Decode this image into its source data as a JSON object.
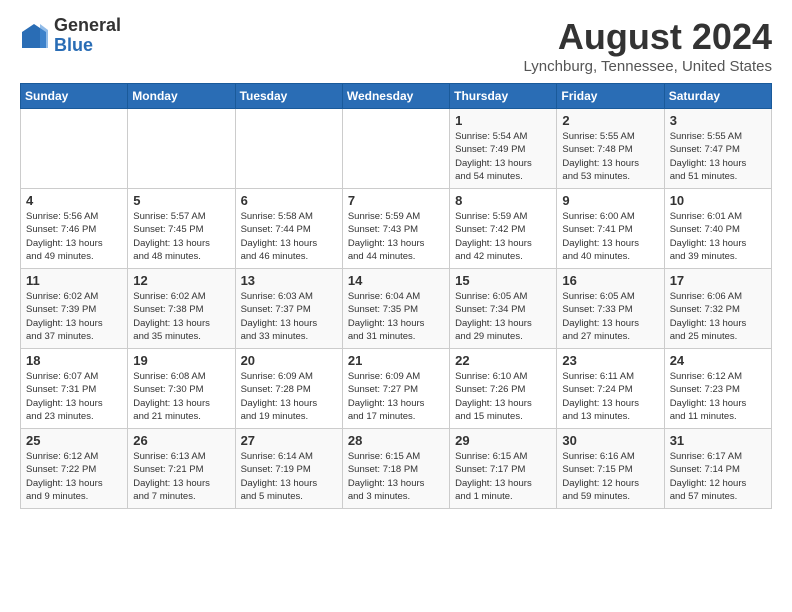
{
  "logo": {
    "general": "General",
    "blue": "Blue"
  },
  "title": "August 2024",
  "location": "Lynchburg, Tennessee, United States",
  "days_of_week": [
    "Sunday",
    "Monday",
    "Tuesday",
    "Wednesday",
    "Thursday",
    "Friday",
    "Saturday"
  ],
  "weeks": [
    [
      {
        "day": "",
        "info": ""
      },
      {
        "day": "",
        "info": ""
      },
      {
        "day": "",
        "info": ""
      },
      {
        "day": "",
        "info": ""
      },
      {
        "day": "1",
        "info": "Sunrise: 5:54 AM\nSunset: 7:49 PM\nDaylight: 13 hours\nand 54 minutes."
      },
      {
        "day": "2",
        "info": "Sunrise: 5:55 AM\nSunset: 7:48 PM\nDaylight: 13 hours\nand 53 minutes."
      },
      {
        "day": "3",
        "info": "Sunrise: 5:55 AM\nSunset: 7:47 PM\nDaylight: 13 hours\nand 51 minutes."
      }
    ],
    [
      {
        "day": "4",
        "info": "Sunrise: 5:56 AM\nSunset: 7:46 PM\nDaylight: 13 hours\nand 49 minutes."
      },
      {
        "day": "5",
        "info": "Sunrise: 5:57 AM\nSunset: 7:45 PM\nDaylight: 13 hours\nand 48 minutes."
      },
      {
        "day": "6",
        "info": "Sunrise: 5:58 AM\nSunset: 7:44 PM\nDaylight: 13 hours\nand 46 minutes."
      },
      {
        "day": "7",
        "info": "Sunrise: 5:59 AM\nSunset: 7:43 PM\nDaylight: 13 hours\nand 44 minutes."
      },
      {
        "day": "8",
        "info": "Sunrise: 5:59 AM\nSunset: 7:42 PM\nDaylight: 13 hours\nand 42 minutes."
      },
      {
        "day": "9",
        "info": "Sunrise: 6:00 AM\nSunset: 7:41 PM\nDaylight: 13 hours\nand 40 minutes."
      },
      {
        "day": "10",
        "info": "Sunrise: 6:01 AM\nSunset: 7:40 PM\nDaylight: 13 hours\nand 39 minutes."
      }
    ],
    [
      {
        "day": "11",
        "info": "Sunrise: 6:02 AM\nSunset: 7:39 PM\nDaylight: 13 hours\nand 37 minutes."
      },
      {
        "day": "12",
        "info": "Sunrise: 6:02 AM\nSunset: 7:38 PM\nDaylight: 13 hours\nand 35 minutes."
      },
      {
        "day": "13",
        "info": "Sunrise: 6:03 AM\nSunset: 7:37 PM\nDaylight: 13 hours\nand 33 minutes."
      },
      {
        "day": "14",
        "info": "Sunrise: 6:04 AM\nSunset: 7:35 PM\nDaylight: 13 hours\nand 31 minutes."
      },
      {
        "day": "15",
        "info": "Sunrise: 6:05 AM\nSunset: 7:34 PM\nDaylight: 13 hours\nand 29 minutes."
      },
      {
        "day": "16",
        "info": "Sunrise: 6:05 AM\nSunset: 7:33 PM\nDaylight: 13 hours\nand 27 minutes."
      },
      {
        "day": "17",
        "info": "Sunrise: 6:06 AM\nSunset: 7:32 PM\nDaylight: 13 hours\nand 25 minutes."
      }
    ],
    [
      {
        "day": "18",
        "info": "Sunrise: 6:07 AM\nSunset: 7:31 PM\nDaylight: 13 hours\nand 23 minutes."
      },
      {
        "day": "19",
        "info": "Sunrise: 6:08 AM\nSunset: 7:30 PM\nDaylight: 13 hours\nand 21 minutes."
      },
      {
        "day": "20",
        "info": "Sunrise: 6:09 AM\nSunset: 7:28 PM\nDaylight: 13 hours\nand 19 minutes."
      },
      {
        "day": "21",
        "info": "Sunrise: 6:09 AM\nSunset: 7:27 PM\nDaylight: 13 hours\nand 17 minutes."
      },
      {
        "day": "22",
        "info": "Sunrise: 6:10 AM\nSunset: 7:26 PM\nDaylight: 13 hours\nand 15 minutes."
      },
      {
        "day": "23",
        "info": "Sunrise: 6:11 AM\nSunset: 7:24 PM\nDaylight: 13 hours\nand 13 minutes."
      },
      {
        "day": "24",
        "info": "Sunrise: 6:12 AM\nSunset: 7:23 PM\nDaylight: 13 hours\nand 11 minutes."
      }
    ],
    [
      {
        "day": "25",
        "info": "Sunrise: 6:12 AM\nSunset: 7:22 PM\nDaylight: 13 hours\nand 9 minutes."
      },
      {
        "day": "26",
        "info": "Sunrise: 6:13 AM\nSunset: 7:21 PM\nDaylight: 13 hours\nand 7 minutes."
      },
      {
        "day": "27",
        "info": "Sunrise: 6:14 AM\nSunset: 7:19 PM\nDaylight: 13 hours\nand 5 minutes."
      },
      {
        "day": "28",
        "info": "Sunrise: 6:15 AM\nSunset: 7:18 PM\nDaylight: 13 hours\nand 3 minutes."
      },
      {
        "day": "29",
        "info": "Sunrise: 6:15 AM\nSunset: 7:17 PM\nDaylight: 13 hours\nand 1 minute."
      },
      {
        "day": "30",
        "info": "Sunrise: 6:16 AM\nSunset: 7:15 PM\nDaylight: 12 hours\nand 59 minutes."
      },
      {
        "day": "31",
        "info": "Sunrise: 6:17 AM\nSunset: 7:14 PM\nDaylight: 12 hours\nand 57 minutes."
      }
    ]
  ]
}
